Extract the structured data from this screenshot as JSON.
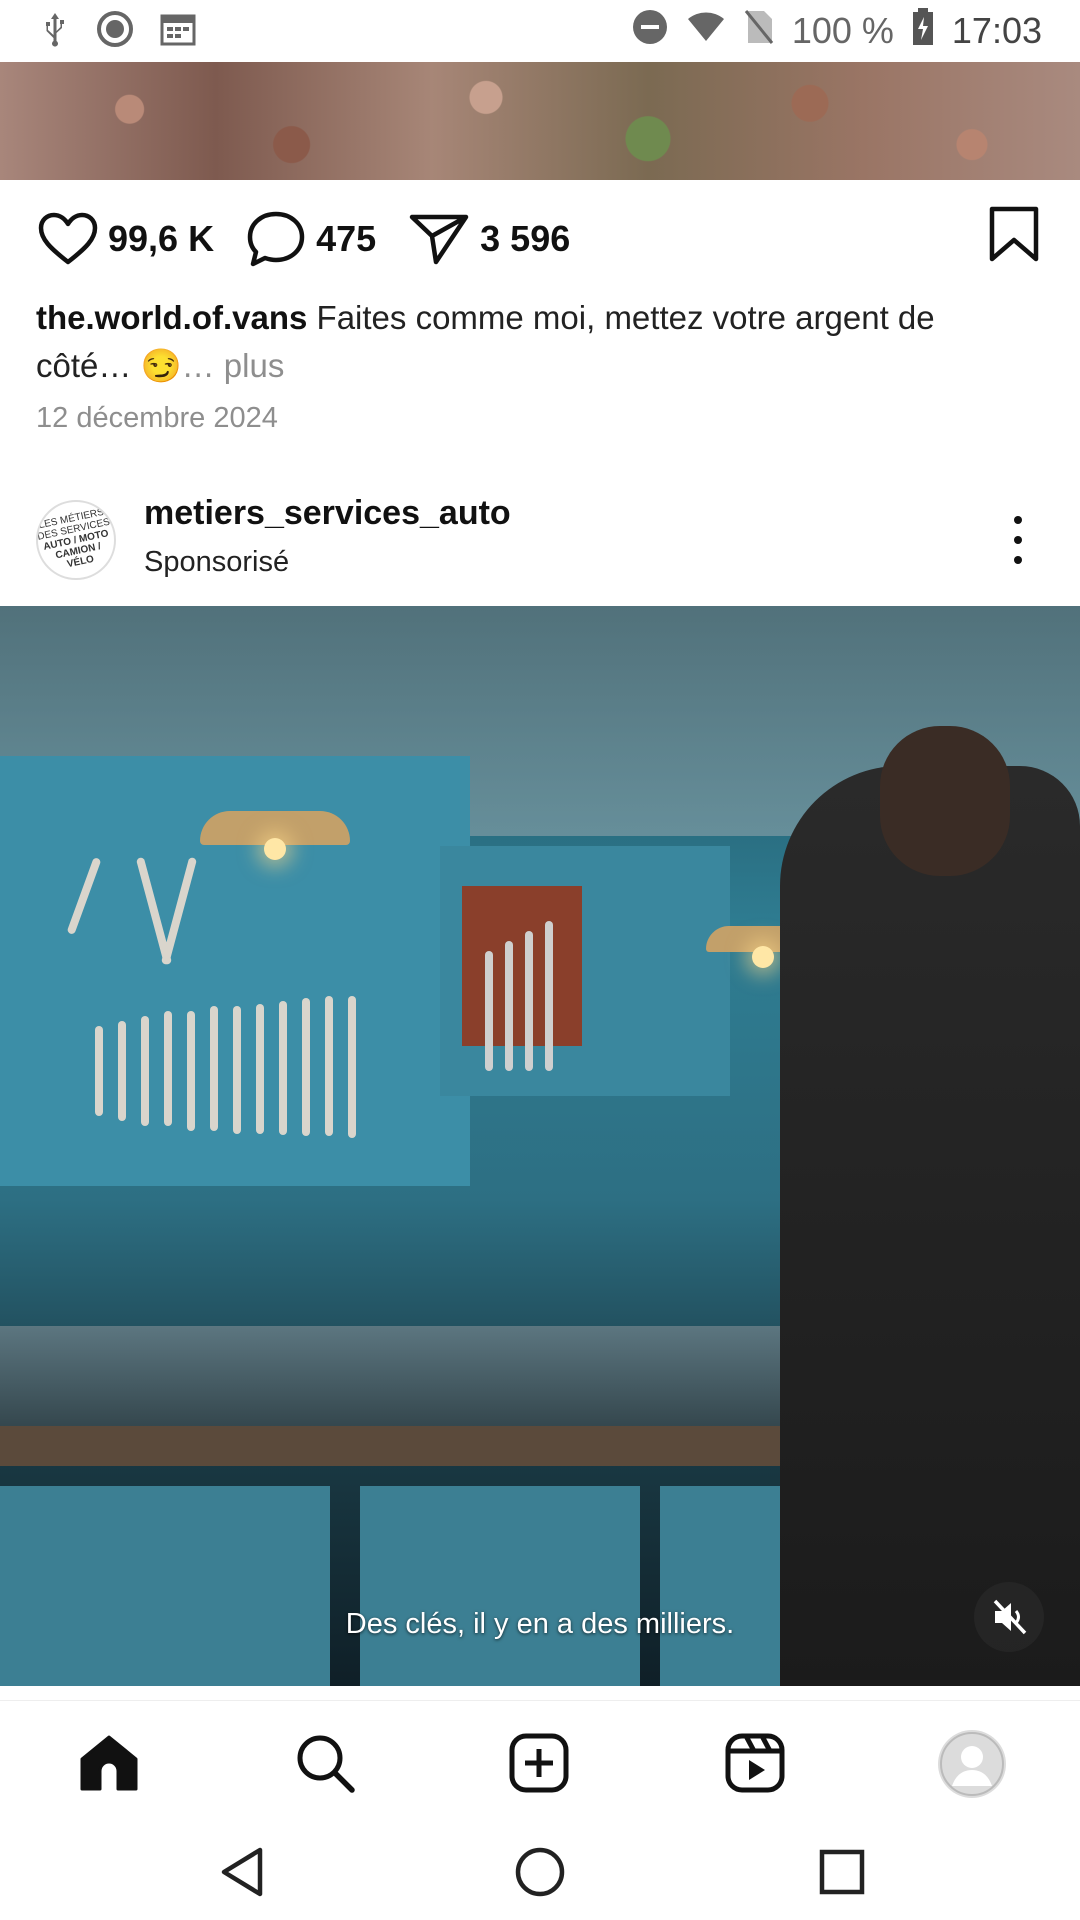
{
  "status_bar": {
    "battery": "100 %",
    "time": "17:03",
    "icons_left": [
      "usb-icon",
      "wordpress-icon",
      "calendar-icon"
    ],
    "icons_right": [
      "dnd-icon",
      "wifi-icon",
      "no-sim-icon",
      "battery-icon"
    ]
  },
  "post": {
    "likes": "99,6 K",
    "comments": "475",
    "shares": "3 596",
    "caption_user": "the.world.of.vans",
    "caption_text": " Faites comme moi, mettez votre argent de côté… 😏",
    "caption_more": "… plus",
    "date": "12 décembre 2024"
  },
  "sponsored_post": {
    "username": "metiers_services_auto",
    "subtitle": "Sponsorisé",
    "avatar_logo_text": "LES MÉTIERS DES SERVICES AUTO / MOTO CAMION / VÉLO",
    "video_subtitle": "Des clés, il y en a des milliers."
  },
  "bottom_nav": {
    "items": [
      "home-icon",
      "search-icon",
      "create-icon",
      "reels-icon",
      "profile-icon"
    ],
    "active": "home"
  },
  "android_nav": [
    "back-icon",
    "home-circle-icon",
    "recents-icon"
  ]
}
